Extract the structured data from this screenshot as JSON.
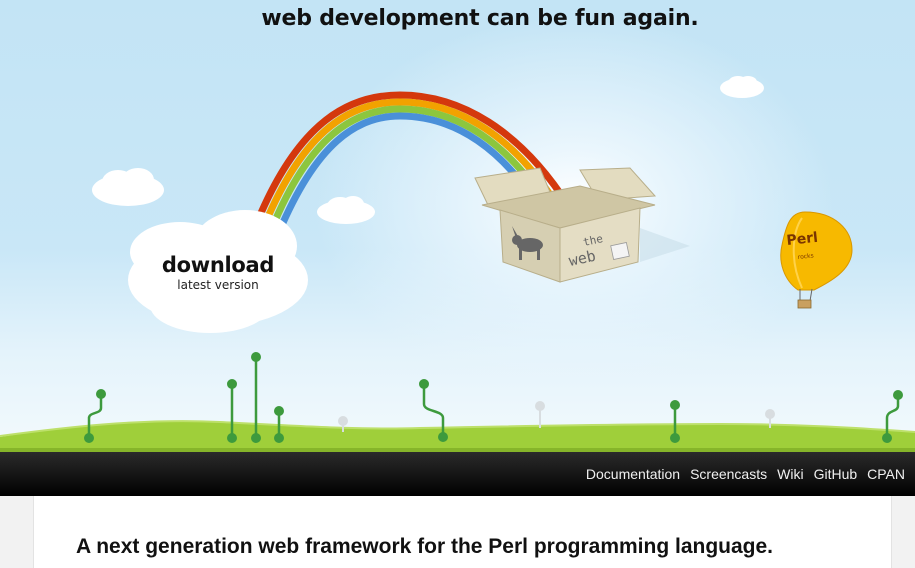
{
  "header": {
    "tagline": "web development can be fun again."
  },
  "hero": {
    "download_label": "download",
    "download_sublabel": "latest version",
    "box_text_line1": "the",
    "box_text_line2": "web",
    "balloon_text": "Perl",
    "balloon_subtext": "rocks"
  },
  "nav": {
    "items": [
      {
        "label": "Documentation"
      },
      {
        "label": "Screencasts"
      },
      {
        "label": "Wiki"
      },
      {
        "label": "GitHub"
      },
      {
        "label": "CPAN"
      }
    ]
  },
  "content": {
    "headline": "A next generation web framework for the Perl programming language."
  },
  "colors": {
    "sky": "#c6e6f7",
    "grass": "#9fcf3a",
    "navbar": "#111111",
    "balloon": "#f5b800",
    "box": "#ddd6b8"
  }
}
